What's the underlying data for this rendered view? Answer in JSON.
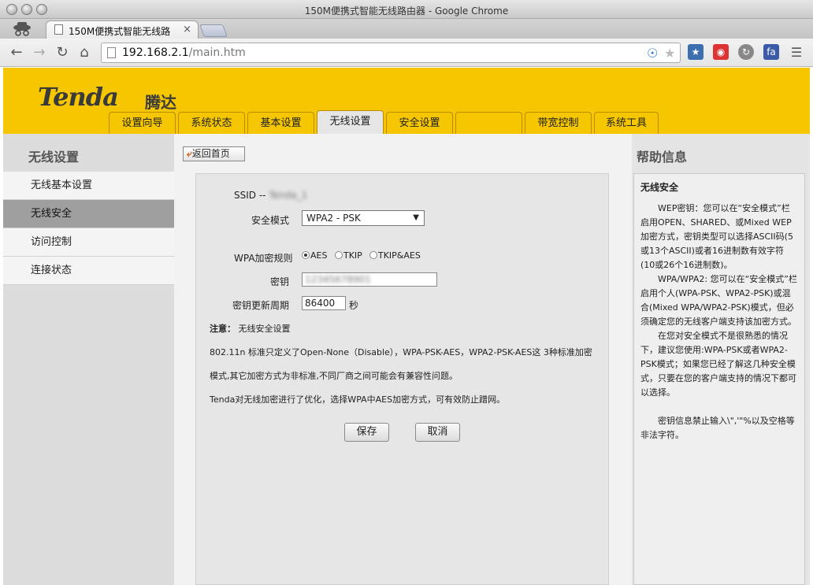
{
  "window": {
    "title": "150M便携式智能无线路由器 - Google Chrome"
  },
  "tab": {
    "title": "150M便携式智能无线路",
    "close": "×"
  },
  "address": {
    "host": "192.168.2.1",
    "path": "/main.htm"
  },
  "icons": {
    "back": "back-arrow-icon",
    "forward": "forward-arrow-icon",
    "reload": "reload-icon",
    "home": "home-icon",
    "star": "star-icon",
    "menu": "menu-icon"
  },
  "banner": {
    "logo": "Tenda",
    "logo_cn": "腾达",
    "tabs": [
      "设置向导",
      "系统状态",
      "基本设置",
      "无线设置",
      "安全设置",
      "",
      "带宽控制",
      "系统工具"
    ],
    "active_tab": "无线设置",
    "color": "#f6c700"
  },
  "sidebar": {
    "title": "无线设置",
    "items": [
      "无线基本设置",
      "无线安全",
      "访问控制",
      "连接状态"
    ],
    "active": "无线安全"
  },
  "main": {
    "home_button": "返回首页",
    "ssid_label": "SSID --",
    "ssid_value": "Tenda_1",
    "security_mode_label": "安全模式",
    "security_mode_value": "WPA2 - PSK",
    "cipher_label": "WPA加密规则",
    "cipher_options": [
      "AES",
      "TKIP",
      "TKIP&AES"
    ],
    "cipher_selected": "AES",
    "key_label": "密钥",
    "key_value": "12345678901",
    "renew_label": "密钥更新周期",
    "renew_value": "86400",
    "renew_unit": "秒",
    "note_title": "注意：",
    "note_subject": "无线安全设置",
    "note_line1": "802.11n 标准只定义了Open-None（Disable），WPA-PSK-AES，WPA2-PSK-AES这 3种标准加密",
    "note_line2": "模式,其它加密方式为非标准,不同厂商之间可能会有兼容性问题。",
    "note_line3": "Tenda对无线加密进行了优化，选择WPA中AES加密方式，可有效防止蹭网。",
    "save": "保存",
    "cancel": "取消"
  },
  "help": {
    "title": "帮助信息",
    "heading": "无线安全",
    "p1": "WEP密钥：您可以在“安全模式”栏启用OPEN、SHARED、或Mixed WEP加密方式，密钥类型可以选择ASCII码(5或13个ASCII)或者16进制数有效字符(10或26个16进制数)。",
    "p2": "WPA/WPA2: 您可以在“安全模式”栏启用个人(WPA-PSK、WPA2-PSK)或混合(Mixed WPA/WPA2-PSK)模式，但必须确定您的无线客户端支持该加密方式。",
    "p3": "在您对安全模式不是很熟悉的情况下，建议您使用:WPA-PSK或者WPA2-PSK模式；如果您已经了解这几种安全模式，只要在您的客户端支持的情况下都可以选择。",
    "p4": "密钥信息禁止输入\\\",'\"%以及空格等非法字符。"
  }
}
